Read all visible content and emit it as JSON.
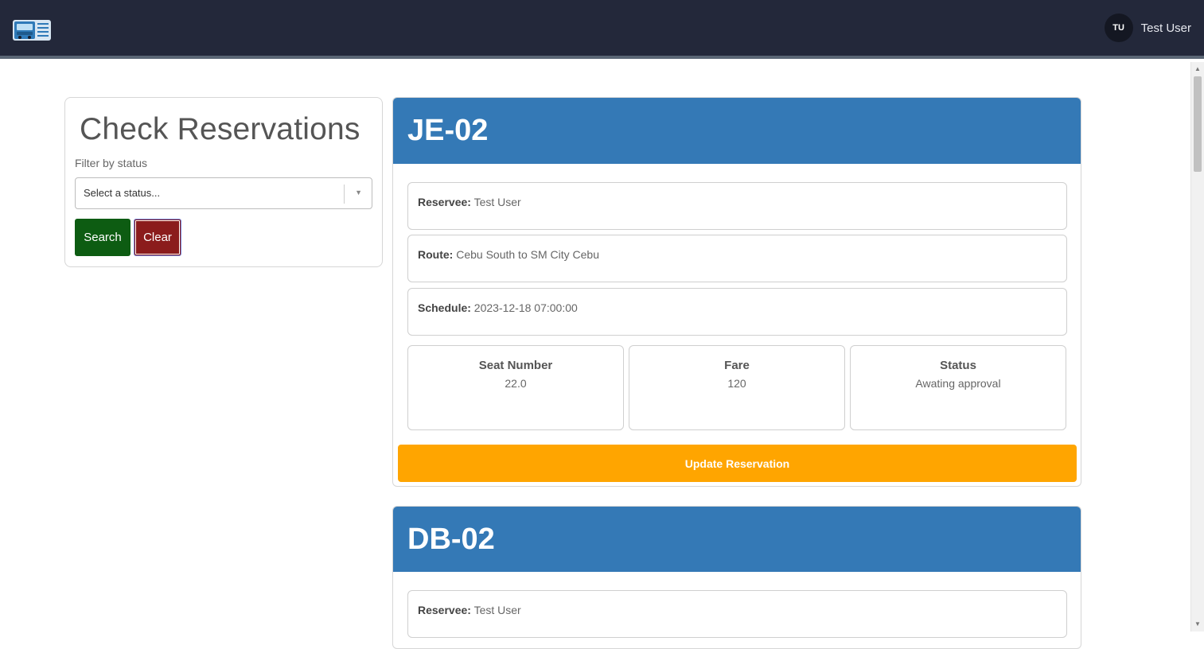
{
  "navbar": {
    "logo_icon": "bus-ticket-icon",
    "user_initials": "TU",
    "user_name": "Test User",
    "background": "#23283a"
  },
  "filter": {
    "title": "Check Reservations",
    "label": "Filter by status",
    "select_placeholder": "Select a status...",
    "search_label": "Search",
    "clear_label": "Clear"
  },
  "reservations": [
    {
      "code": "JE-02",
      "reservee_label": "Reservee:",
      "reservee": "Test User",
      "route_label": "Route:",
      "route": "Cebu South to SM City Cebu",
      "schedule_label": "Schedule:",
      "schedule": "2023-12-18 07:00:00",
      "seat_label": "Seat Number",
      "seat": "22.0",
      "fare_label": "Fare",
      "fare": "120",
      "status_label": "Status",
      "status": "Awating approval",
      "update_label": "Update Reservation"
    },
    {
      "code": "DB-02",
      "reservee_label": "Reservee:",
      "reservee": "Test User"
    }
  ],
  "colors": {
    "header_blue": "#3479b6",
    "search_green": "#0d5c12",
    "clear_red": "#8b1c1c",
    "update_orange": "#ffa500"
  }
}
